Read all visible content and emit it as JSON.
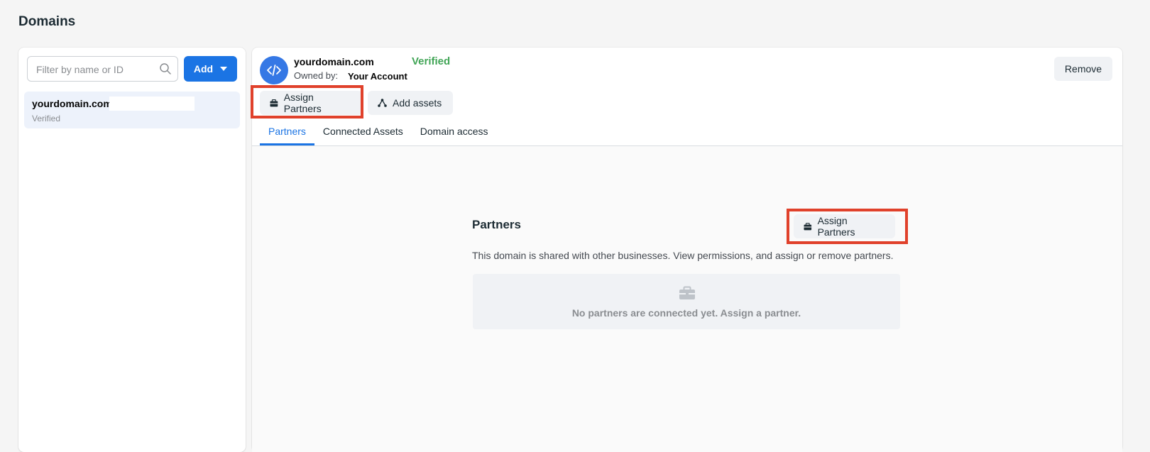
{
  "page": {
    "title": "Domains"
  },
  "sidebar": {
    "search_placeholder": "Filter by name or ID",
    "add_button_label": "Add",
    "items": [
      {
        "name": "yourdomain.com",
        "status": "Verified"
      }
    ]
  },
  "detail": {
    "domain_name": "yourdomain.com",
    "verification_status": "Verified",
    "owned_by_label": "Owned by:",
    "owned_by_value": "Your Account",
    "remove_label": "Remove",
    "assign_partners_label": "Assign Partners",
    "add_assets_label": "Add assets",
    "tabs": [
      {
        "label": "Partners",
        "active": true
      },
      {
        "label": "Connected Assets",
        "active": false
      },
      {
        "label": "Domain access",
        "active": false
      }
    ]
  },
  "partners_section": {
    "title": "Partners",
    "assign_label": "Assign Partners",
    "description": "This domain is shared with other businesses. View permissions, and assign or remove partners.",
    "empty_message": "No partners are connected yet. Assign a partner."
  },
  "colors": {
    "accent": "#1b74e4",
    "verified": "#42a557",
    "highlight": "#e0412b"
  },
  "icons": [
    "search-icon",
    "caret-down-icon",
    "code-icon",
    "briefcase-icon",
    "share-nodes-icon"
  ]
}
